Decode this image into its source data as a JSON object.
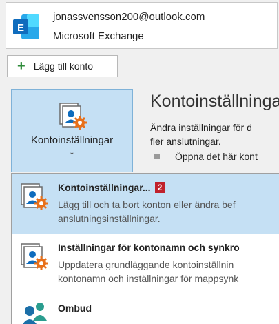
{
  "account": {
    "email": "jonassvensson200@outlook.com",
    "type": "Microsoft Exchange",
    "logo_letter": "E"
  },
  "add_account": {
    "label": "Lägg till konto"
  },
  "account_settings_button": {
    "label": "Kontoinställningar",
    "chevron": "⌄"
  },
  "section": {
    "title": "Kontoinställninga",
    "desc_line1": "Ändra inställningar för d",
    "desc_line2": "fler anslutningar.",
    "bullet": "Öppna det här kont"
  },
  "menu": {
    "items": [
      {
        "title": "Kontoinställningar...",
        "badge": "2",
        "desc_line1": "Lägg till och ta bort konton eller ändra bef",
        "desc_line2": "anslutningsinställningar.",
        "icon": "account-settings-icon"
      },
      {
        "title": "Inställningar för kontonamn och synkro",
        "desc_line1": "Uppdatera grundläggande kontoinställnin",
        "desc_line2": "kontonamn och inställningar för mappsynk",
        "icon": "account-name-sync-icon"
      },
      {
        "title": "Ombud",
        "icon": "delegate-people-icon"
      }
    ]
  },
  "colors": {
    "selected_bg": "#c5e0f4",
    "exchange_blue": "#0f6cbd",
    "gear_orange": "#e8701a",
    "badge_red": "#c0212b",
    "plus_green": "#2e8b3a"
  }
}
